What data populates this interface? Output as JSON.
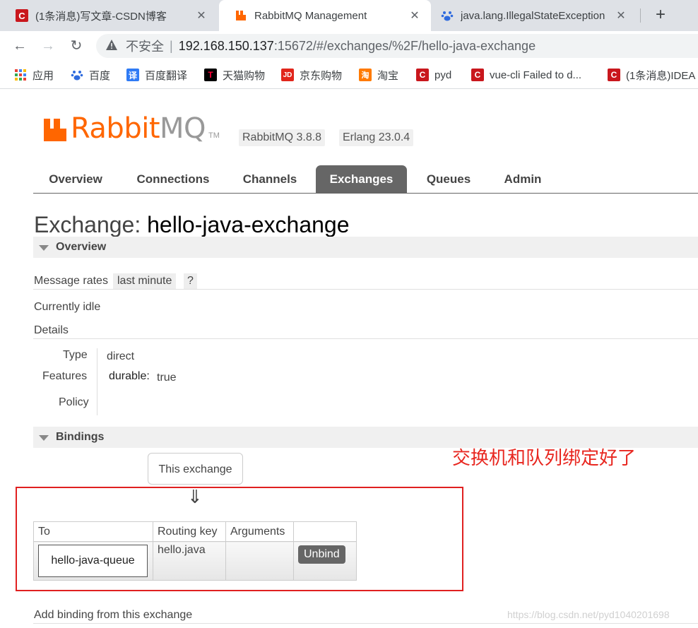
{
  "browser": {
    "tabs": [
      {
        "title": "(1条消息)写文章-CSDN博客",
        "icon": "csdn-icon",
        "active": false
      },
      {
        "title": "RabbitMQ Management",
        "icon": "rabbitmq-icon",
        "active": true
      },
      {
        "title": "java.lang.IllegalStateException",
        "icon": "baidu-paw-icon",
        "active": false
      }
    ],
    "close_glyph": "✕",
    "new_tab_glyph": "+",
    "nav": {
      "back": "←",
      "forward": "→",
      "reload": "↻"
    },
    "address": {
      "security_label": "不安全",
      "separator": "|",
      "host": "192.168.150.137",
      "rest": ":15672/#/exchanges/%2F/hello-java-exchange"
    },
    "bookmarks": [
      {
        "label": "应用",
        "icon": "apps-grid-icon"
      },
      {
        "label": "百度",
        "icon": "baidu-paw-icon"
      },
      {
        "label": "百度翻译",
        "icon": "translate-icon"
      },
      {
        "label": "天猫购物",
        "icon": "tmall-icon"
      },
      {
        "label": "京东购物",
        "icon": "jd-icon"
      },
      {
        "label": "淘宝",
        "icon": "taobao-icon"
      },
      {
        "label": "pyd",
        "icon": "csdn-icon"
      },
      {
        "label": "vue-cli Failed to d...",
        "icon": "csdn-icon"
      },
      {
        "label": "(1条消息)IDEA",
        "icon": "csdn-icon"
      }
    ],
    "bookmark_icon_glyphs": {
      "translate": "译",
      "tmall": "T",
      "jd": "JD",
      "taobao": "淘",
      "csdn": "C"
    }
  },
  "app": {
    "logo": {
      "rabbit": "Rabbit",
      "mq": "MQ",
      "tm": "TM"
    },
    "rabbitmq_version": "RabbitMQ 3.8.8",
    "erlang_version": "Erlang 23.0.4",
    "nav_tabs": [
      "Overview",
      "Connections",
      "Channels",
      "Exchanges",
      "Queues",
      "Admin"
    ],
    "selected_tab": "Exchanges"
  },
  "page": {
    "title_prefix": "Exchange:",
    "exchange_name": "hello-java-exchange",
    "overview": {
      "heading": "Overview",
      "message_rates_label": "Message rates",
      "rates_period": "last minute",
      "help": "?",
      "idle_text": "Currently idle",
      "details_label": "Details",
      "type_label": "Type",
      "type_value": "direct",
      "features_label": "Features",
      "durable_key": "durable:",
      "durable_value": "true",
      "policy_label": "Policy"
    },
    "bindings": {
      "heading": "Bindings",
      "this_exchange": "This exchange",
      "arrow": "⇓",
      "columns": [
        "To",
        "Routing key",
        "Arguments",
        ""
      ],
      "rows": [
        {
          "to": "hello-java-queue",
          "routing_key": "hello.java",
          "arguments": "",
          "action": "Unbind"
        }
      ]
    },
    "add_binding_label": "Add binding from this exchange"
  },
  "annotation": {
    "text": "交换机和队列绑定好了",
    "color": "#e8261f"
  },
  "watermark": "https://blog.csdn.net/pyd1040201698"
}
